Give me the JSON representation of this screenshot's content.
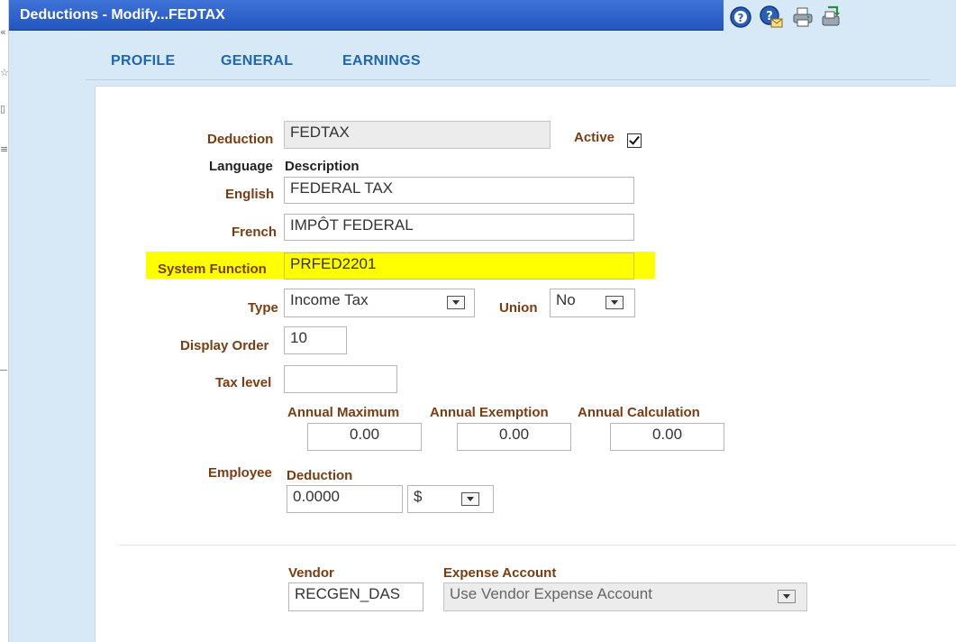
{
  "window": {
    "title": "Deductions - Modify...FEDTAX",
    "toolbar_icons": [
      "help-icon",
      "email-help-icon",
      "print-icon",
      "export-icon"
    ]
  },
  "tabs": [
    {
      "label": "PROFILE"
    },
    {
      "label": "GENERAL"
    },
    {
      "label": "EARNINGS"
    }
  ],
  "form": {
    "deduction": {
      "label": "Deduction",
      "value": "FEDTAX"
    },
    "active": {
      "label": "Active",
      "checked": true
    },
    "language_header": {
      "language": "Language",
      "description": "Description"
    },
    "english": {
      "label": "English",
      "value": "FEDERAL  TAX"
    },
    "french": {
      "label": "French",
      "value": "IMPÔT FEDERAL"
    },
    "system_function": {
      "label": "System Function",
      "value": "PRFED2201",
      "highlight_color": "#ffff00"
    },
    "type": {
      "label": "Type",
      "value": "Income Tax"
    },
    "union": {
      "label": "Union",
      "value": "No"
    },
    "display_order": {
      "label": "Display Order",
      "value": "10"
    },
    "tax_level": {
      "label": "Tax level",
      "value": ""
    },
    "annual_maximum": {
      "label": "Annual Maximum",
      "value": "0.00"
    },
    "annual_exemption": {
      "label": "Annual Exemption",
      "value": "0.00"
    },
    "annual_calculation": {
      "label": "Annual Calculation",
      "value": "0.00"
    },
    "employee": {
      "label": "Employee"
    },
    "deduction_amount": {
      "label": "Deduction",
      "value": "0.0000",
      "unit": "$"
    },
    "vendor": {
      "label": "Vendor",
      "value": "RECGEN_DAS"
    },
    "expense_account": {
      "label": "Expense Account",
      "value": "Use Vendor Expense Account"
    }
  },
  "colors": {
    "title_bar": "#2f64cc",
    "tab_text": "#1f66b4",
    "label_text": "#7a3c12",
    "background": "#d7e8f7"
  }
}
